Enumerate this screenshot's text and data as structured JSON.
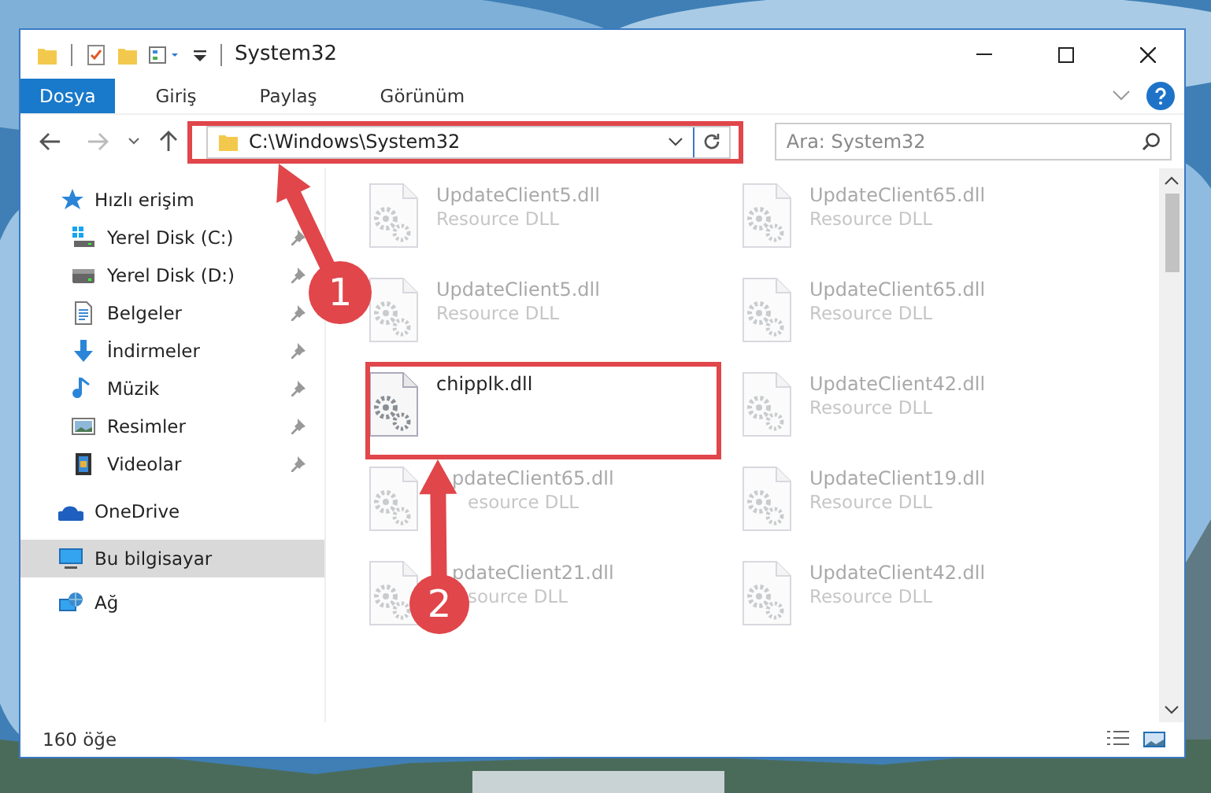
{
  "window": {
    "title": "System32"
  },
  "ribbon_tabs": [
    {
      "label": "Dosya",
      "selected": true
    },
    {
      "label": "Giriş",
      "selected": false
    },
    {
      "label": "Paylaş",
      "selected": false
    },
    {
      "label": "Görünüm",
      "selected": false
    }
  ],
  "address": {
    "path": "C:\\Windows\\System32"
  },
  "search": {
    "placeholder": "Ara: System32"
  },
  "sidebar": {
    "items": [
      {
        "label": "Hızlı erişim",
        "kind": "star",
        "selected": false,
        "children": [
          {
            "label": "Yerel Disk (C:)",
            "kind": "windisk",
            "pinned": true
          },
          {
            "label": "Yerel Disk (D:)",
            "kind": "disk",
            "pinned": true
          },
          {
            "label": "Belgeler",
            "kind": "doc",
            "pinned": true
          },
          {
            "label": "İndirmeler",
            "kind": "download",
            "pinned": true
          },
          {
            "label": "Müzik",
            "kind": "music",
            "pinned": true
          },
          {
            "label": "Resimler",
            "kind": "pictures",
            "pinned": true
          },
          {
            "label": "Videolar",
            "kind": "video",
            "pinned": true
          }
        ]
      },
      {
        "label": "OneDrive",
        "kind": "cloud",
        "selected": false
      },
      {
        "label": "Bu bilgisayar",
        "kind": "pc",
        "selected": true
      },
      {
        "label": "Ağ",
        "kind": "network",
        "selected": false
      }
    ]
  },
  "files": [
    {
      "name": "UpdateClient5.dll",
      "type": "Resource DLL",
      "blurred": true
    },
    {
      "name": "UpdateClient65.dll",
      "type": "Resource DLL",
      "blurred": true
    },
    {
      "name": "UpdateClient5.dll",
      "type": "Resource DLL",
      "blurred": true
    },
    {
      "name": "UpdateClient65.dll",
      "type": "Resource DLL",
      "blurred": true
    },
    {
      "name": "chipplk.dll",
      "blurred": false
    },
    {
      "name": "UpdateClient42.dll",
      "type": "Resource DLL",
      "blurred": true
    },
    {
      "name": "pdateClient65.dll",
      "type": "esource DLL",
      "blurred": true,
      "covered": true
    },
    {
      "name": "UpdateClient19.dll",
      "type": "Resource DLL",
      "blurred": true
    },
    {
      "name": "pdateClient21.dll",
      "type": "source DLL",
      "blurred": true,
      "covered": true
    },
    {
      "name": "UpdateClient42.dll",
      "type": "Resource DLL",
      "blurred": true
    }
  ],
  "status_bar": {
    "item_count": "160 öğe"
  },
  "annotations": [
    {
      "number": "1"
    },
    {
      "number": "2"
    }
  ]
}
